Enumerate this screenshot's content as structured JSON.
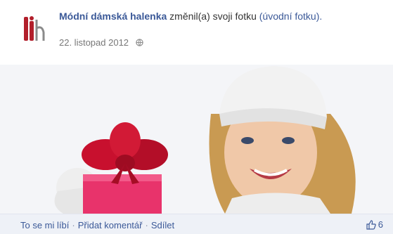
{
  "post": {
    "author": "Módní dámská halenka",
    "action": "změnil(a) svoji fotku",
    "album_link": "(úvodní fotku).",
    "date": "22. listopad 2012",
    "privacy_icon": "globe-icon"
  },
  "photo": {
    "description_icon": "cover-photo"
  },
  "footer": {
    "like": "To se mi líbí",
    "comment": "Přidat komentář",
    "share": "Sdílet",
    "separator": "·",
    "like_icon": "thumbs-up-icon",
    "like_count": "6"
  },
  "colors": {
    "link": "#3b5998",
    "footer_bg": "#eef1f7",
    "gift": "#e8336b",
    "bow": "#c8102e"
  }
}
